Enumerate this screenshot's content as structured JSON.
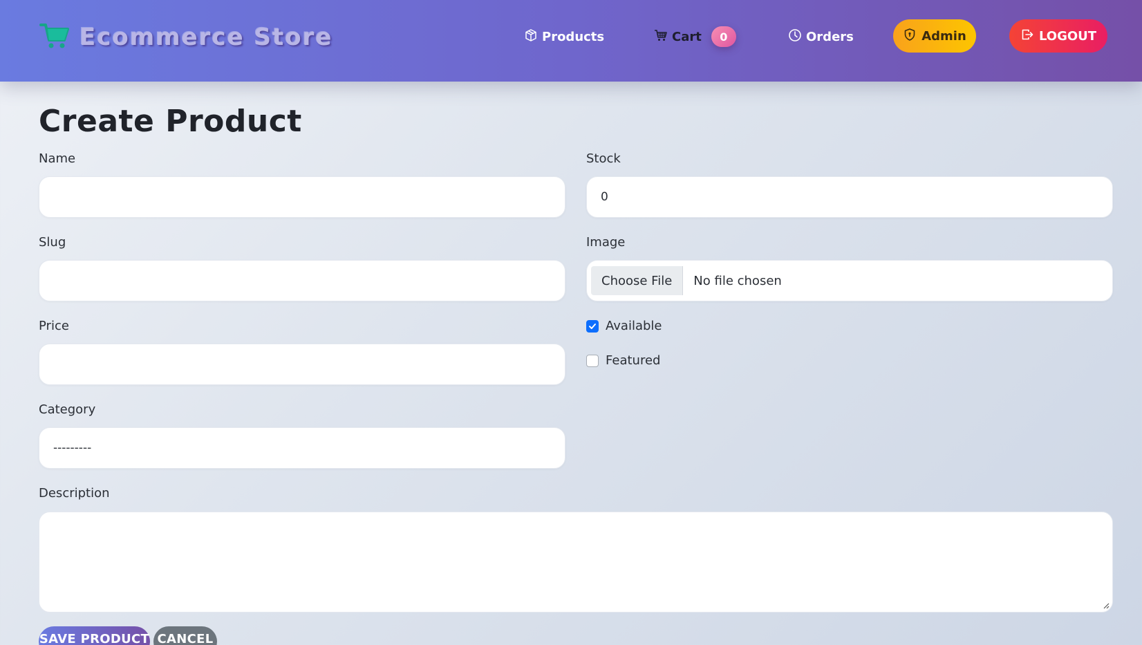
{
  "header": {
    "brand": "Ecommerce Store",
    "nav": {
      "products": "Products",
      "cart": "Cart",
      "cart_count": "0",
      "orders": "Orders",
      "admin": "Admin",
      "logout": "LOGOUT"
    },
    "colors": {
      "navbar_start": "#6a7be0",
      "navbar_end": "#7550a8",
      "admin": "#fdb913",
      "logout": "#f03a47",
      "cart_badge": "#e969a8"
    }
  },
  "form": {
    "title": "Create Product",
    "name": {
      "label": "Name",
      "value": ""
    },
    "slug": {
      "label": "Slug",
      "value": ""
    },
    "price": {
      "label": "Price",
      "value": ""
    },
    "category": {
      "label": "Category",
      "value": "---------"
    },
    "stock": {
      "label": "Stock",
      "value": "0"
    },
    "image": {
      "label": "Image",
      "button": "Choose File",
      "status": "No file chosen"
    },
    "available": {
      "label": "Available",
      "checked": true
    },
    "featured": {
      "label": "Featured",
      "checked": false
    },
    "description": {
      "label": "Description",
      "value": ""
    },
    "actions": {
      "save": "SAVE PRODUCT",
      "cancel": "CANCEL"
    }
  }
}
